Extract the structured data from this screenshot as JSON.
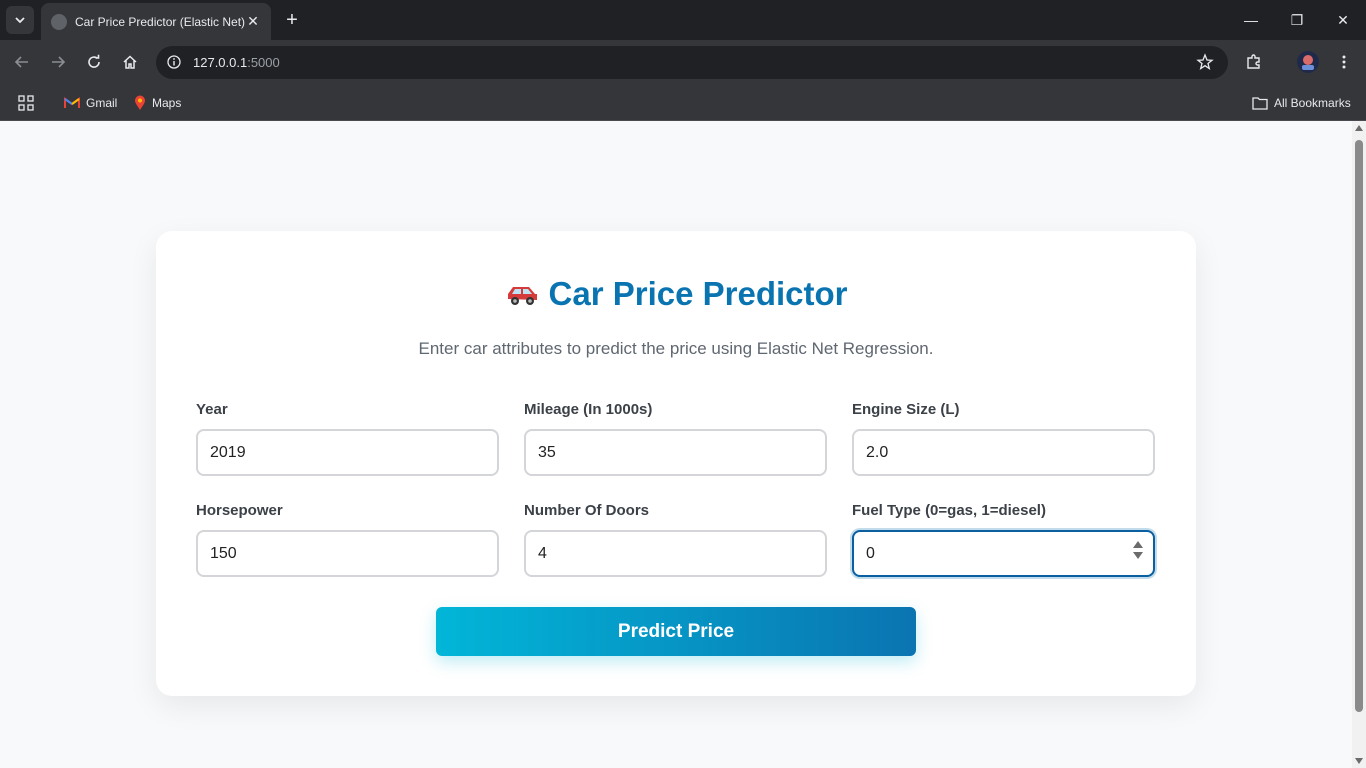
{
  "browser": {
    "tab_title": "Car Price Predictor (Elastic Net)",
    "tab_close": "✕",
    "new_tab": "+",
    "url_host": "127.0.0.1",
    "url_port": ":5000",
    "window_controls": {
      "minimize": "—",
      "restore": "❐",
      "close": "✕"
    },
    "bookmarks": [
      {
        "label": "Gmail",
        "icon": "gmail-icon"
      },
      {
        "label": "Maps",
        "icon": "maps-icon"
      }
    ],
    "all_bookmarks": "All Bookmarks"
  },
  "page": {
    "title_icon": "🚙",
    "title": "Car Price Predictor",
    "subtitle": "Enter car attributes to predict the price using Elastic Net Regression.",
    "fields": [
      {
        "label": "Year",
        "value": "2019"
      },
      {
        "label": "Mileage (In 1000s)",
        "value": "35"
      },
      {
        "label": "Engine Size (L)",
        "value": "2.0"
      },
      {
        "label": "Horsepower",
        "value": "150"
      },
      {
        "label": "Number Of Doors",
        "value": "4"
      },
      {
        "label": "Fuel Type (0=gas, 1=diesel)",
        "value": "0"
      }
    ],
    "button": "Predict Price"
  },
  "colors": {
    "accent": "#0a74b1",
    "button_gradient_start": "#02b6d8",
    "button_gradient_end": "#0a74b1"
  }
}
